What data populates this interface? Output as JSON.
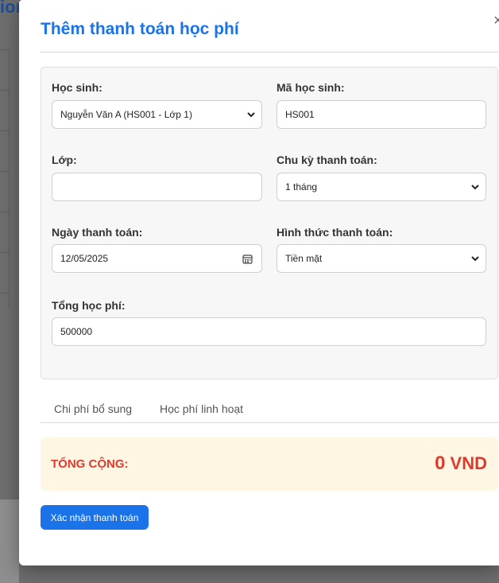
{
  "background": {
    "title_fragment": "ior"
  },
  "modal": {
    "title": "Thêm thanh toán học phí",
    "close_label": "×"
  },
  "form": {
    "student_label": "Học sinh:",
    "student_value": "Nguyễn Văn A (HS001 - Lớp 1)",
    "student_code_label": "Mã học sinh:",
    "student_code_value": "HS001",
    "class_label": "Lớp:",
    "class_value": "",
    "cycle_label": "Chu kỳ thanh toán:",
    "cycle_value": "1 tháng",
    "date_label": "Ngày thanh toán:",
    "date_value": "12/05/2025",
    "method_label": "Hình thức thanh toán:",
    "method_value": "Tiền mặt",
    "total_fee_label": "Tổng học phí:",
    "total_fee_value": "500000"
  },
  "tabs": [
    {
      "label": "Chi phí bổ sung"
    },
    {
      "label": "Học phí linh hoạt"
    }
  ],
  "total": {
    "label": "TỔNG CỘNG:",
    "amount": "0",
    "currency": "VND"
  },
  "actions": {
    "confirm_label": "Xác nhận thanh toán"
  },
  "colors": {
    "primary": "#1a73e8",
    "total_red": "#e03a2f",
    "total_bg": "#fdf6e3"
  }
}
